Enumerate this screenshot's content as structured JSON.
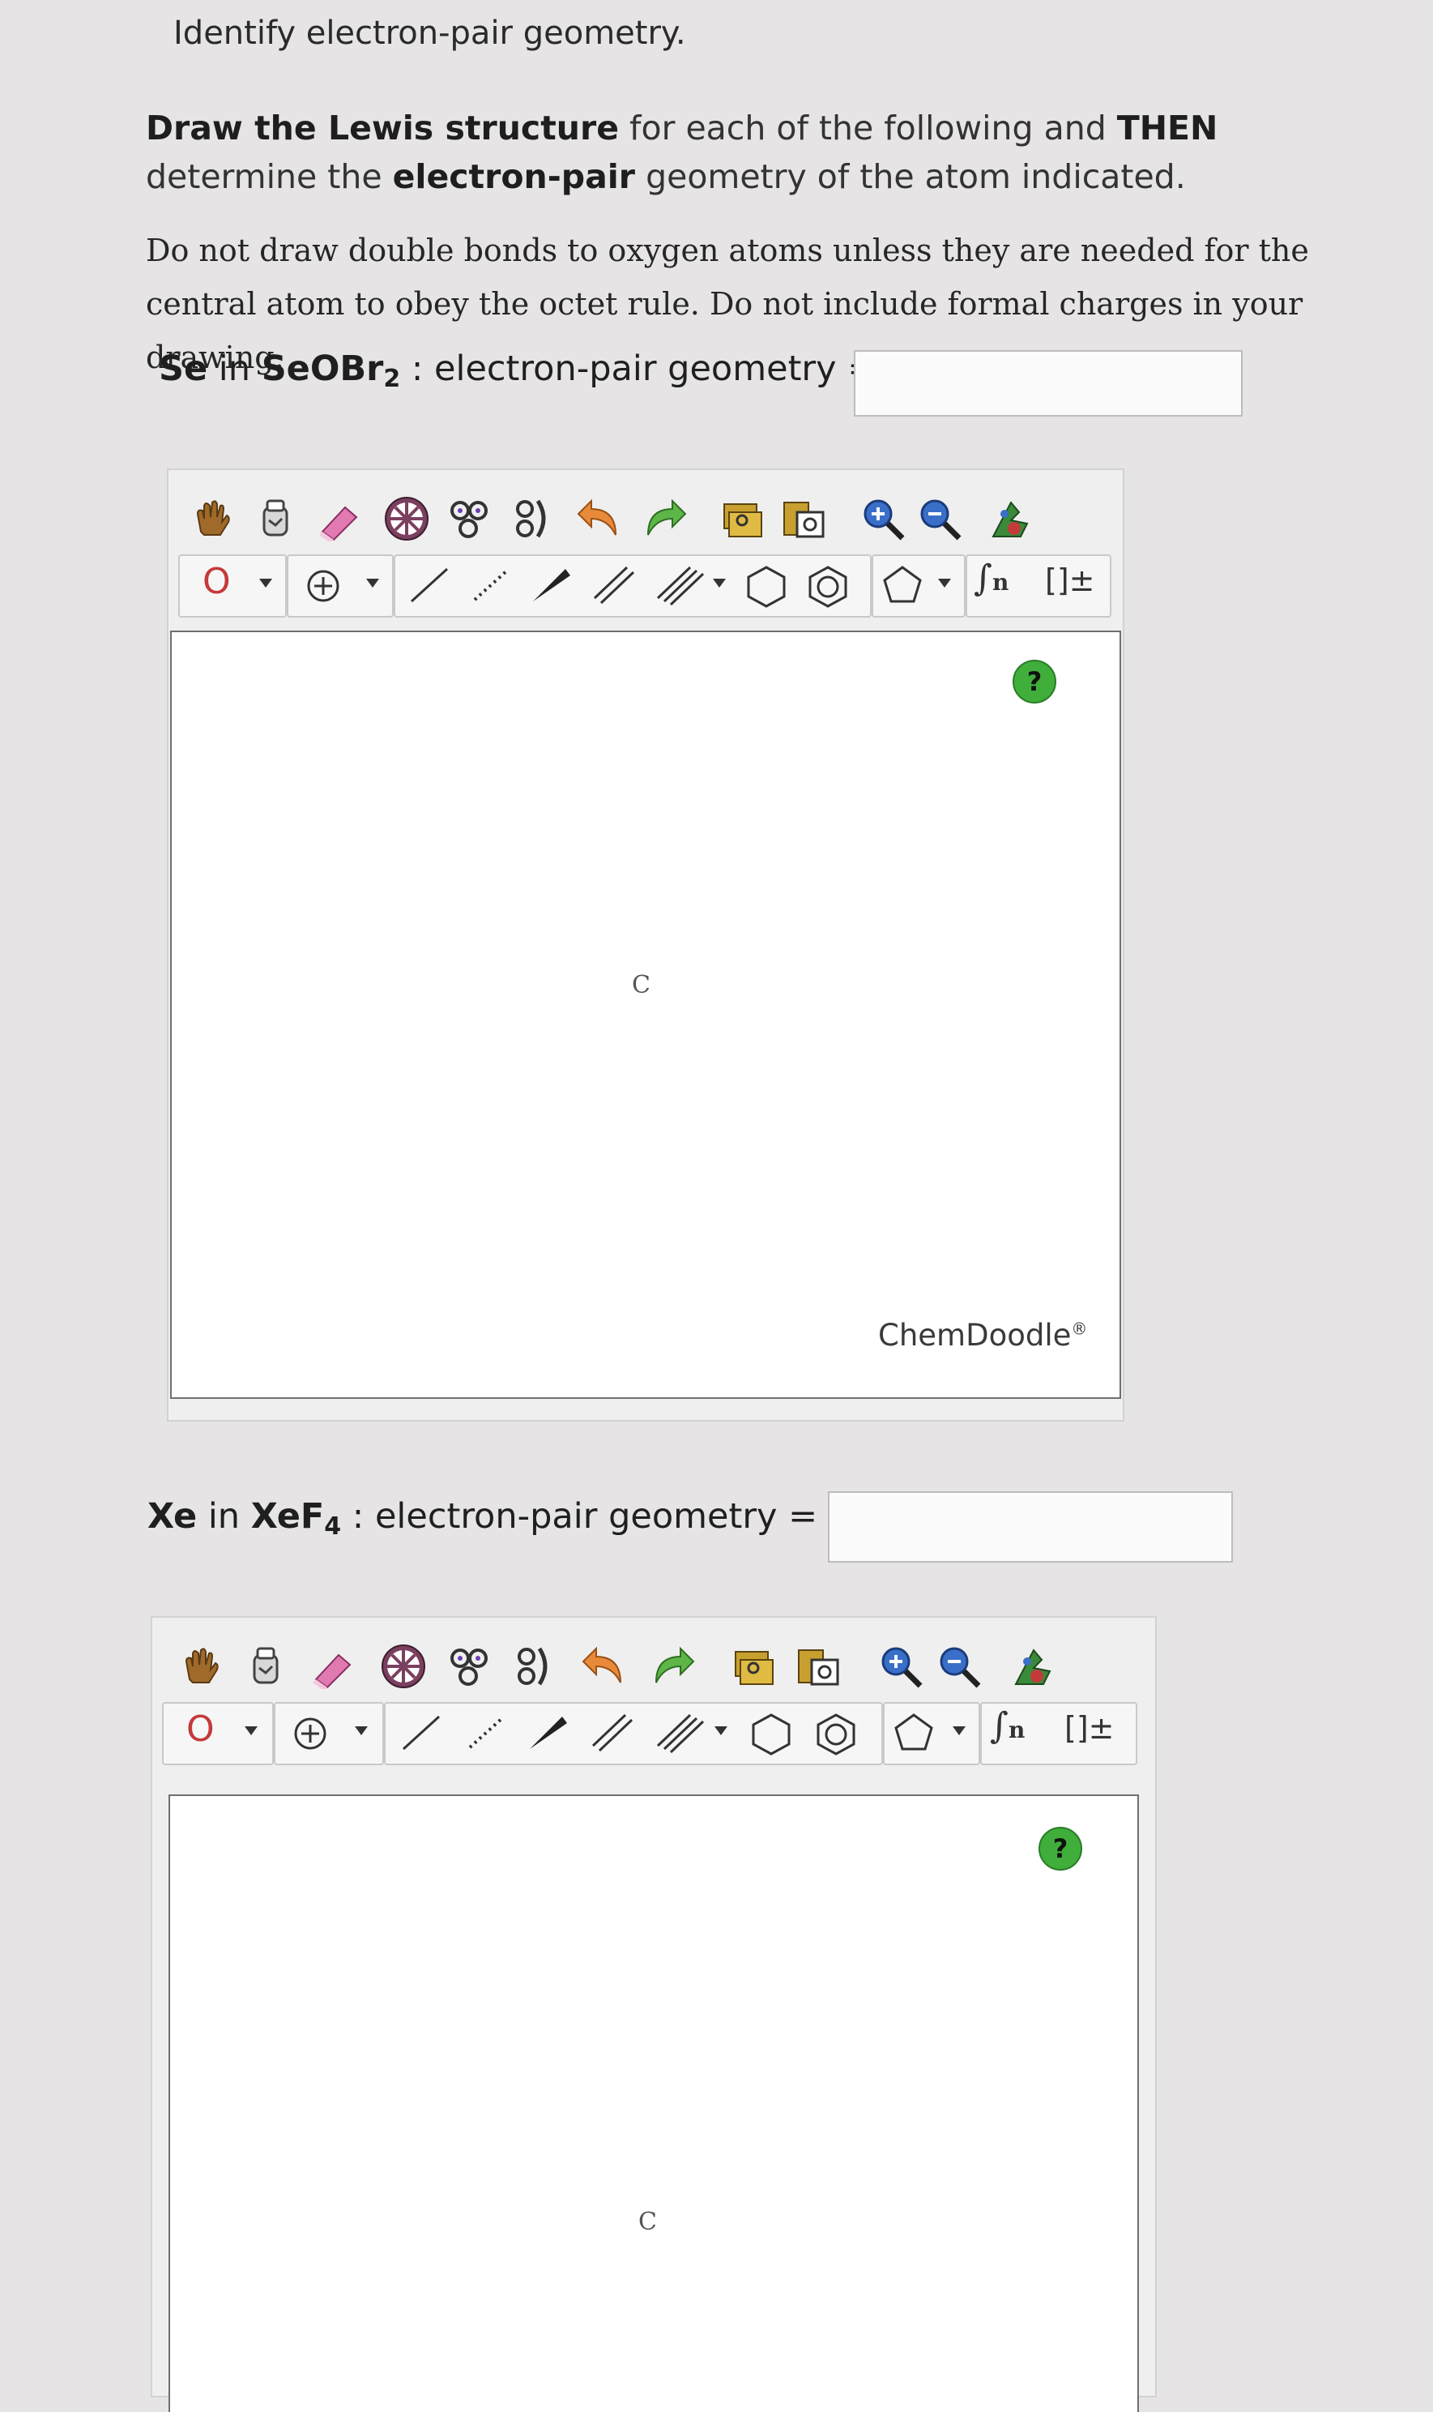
{
  "page_title": "Identify electron-pair geometry.",
  "instructions": {
    "part1_bold": "Draw the Lewis structure",
    "part2": " for each of the following and ",
    "part3_bold": "THEN",
    "part4": " determine the ",
    "part5_bold": "electron-pair",
    "part6": " geometry of the atom indicated."
  },
  "note": "Do not draw double bonds to oxygen atoms unless they are needed for the central atom to obey the octet rule. Do not include formal charges in your drawing.",
  "questions": [
    {
      "atom": "Se",
      "in_text": " in ",
      "formula_main": "SeOBr",
      "formula_sub": "2",
      "label": " : electron-pair geometry =",
      "answer_value": ""
    },
    {
      "atom": "Xe",
      "in_text": " in ",
      "formula_main": "XeF",
      "formula_sub": "4",
      "label": " : electron-pair geometry =",
      "answer_value": ""
    }
  ],
  "sketcher": {
    "atom_selector": "O",
    "canvas_atom": "C",
    "help": "?",
    "brand": "ChemDoodle",
    "brand_mark": "®",
    "toolbar_icons": [
      "hand-icon",
      "lasso-icon",
      "eraser-icon",
      "center-icon",
      "clear-icon",
      "clean-icon",
      "undo-icon",
      "redo-icon",
      "copy-icon",
      "paste-icon",
      "zoom-in-icon",
      "zoom-out-icon",
      "settings-icon"
    ],
    "colors": {
      "help_green": "#3fae3a",
      "undo_orange": "#e88a3a",
      "redo_green": "#5eb548",
      "zoom_blue": "#3a6fc9"
    }
  }
}
